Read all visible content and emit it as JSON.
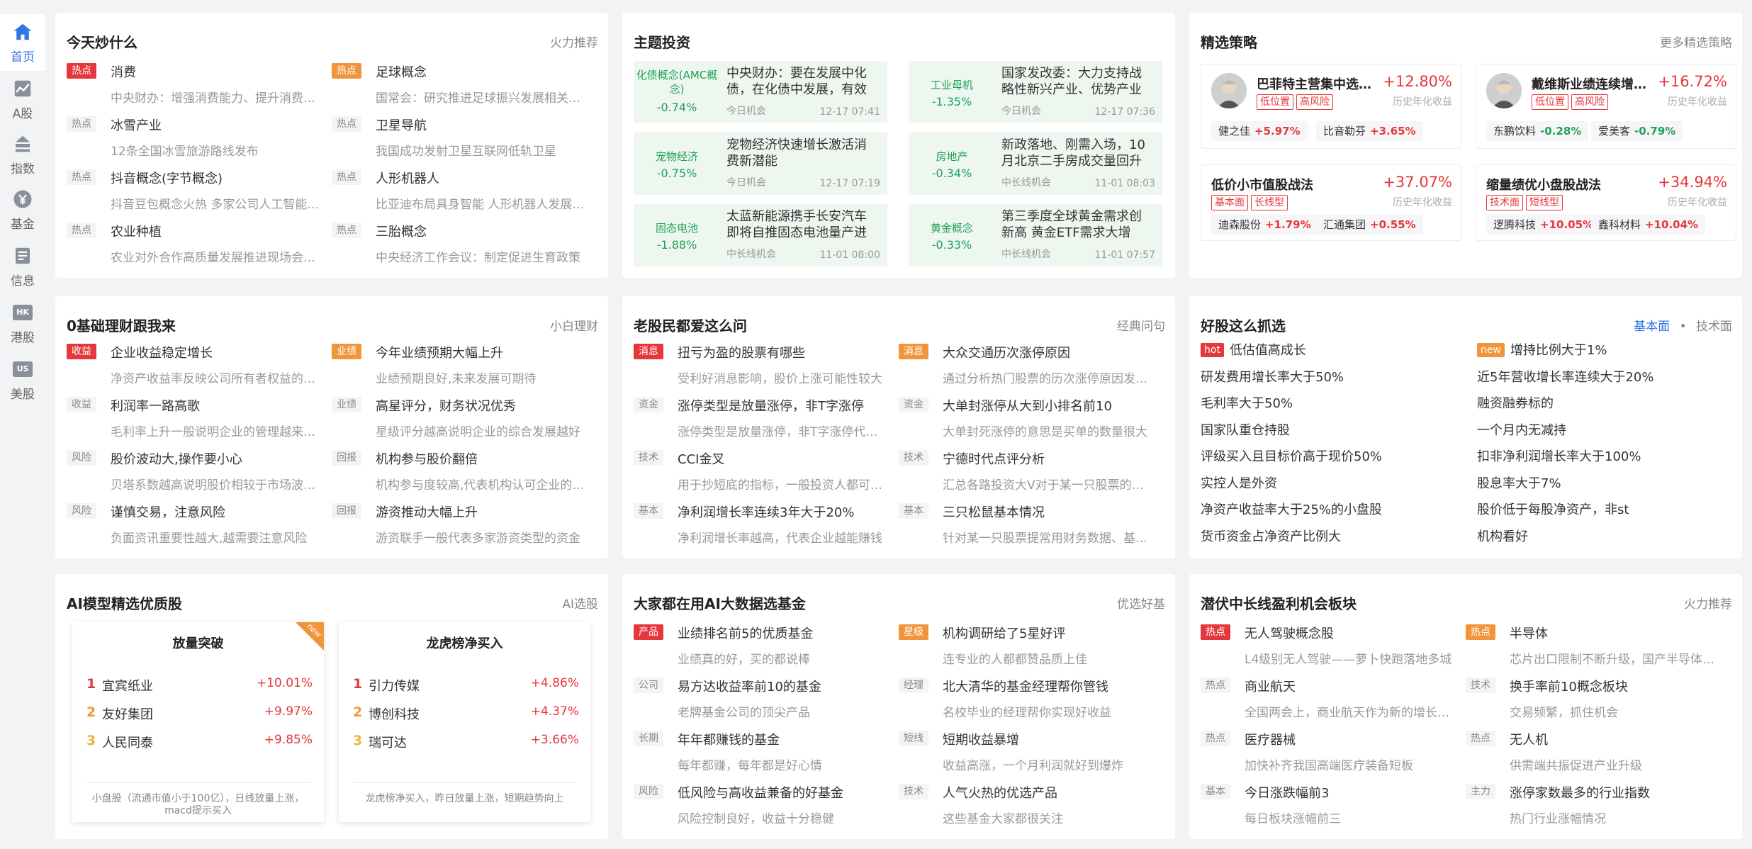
{
  "sidebar": [
    {
      "label": "首页",
      "icon": "home-icon",
      "active": true
    },
    {
      "label": "A股",
      "icon": "a-share-chart-icon"
    },
    {
      "label": "指数",
      "icon": "index-icon"
    },
    {
      "label": "基金",
      "icon": "fund-yen-icon"
    },
    {
      "label": "信息",
      "icon": "info-doc-icon"
    },
    {
      "label": "港股",
      "icon": "hk-icon",
      "badge": "HK"
    },
    {
      "label": "美股",
      "icon": "us-icon",
      "badge": "US"
    }
  ],
  "hot_topics": {
    "title": "今天炒什么",
    "more": "火力推荐",
    "items": [
      {
        "tag": "热点",
        "title": "消费",
        "sub": "中央财办：增强消费能力、提升消费意愿"
      },
      {
        "tag": "热点",
        "title": "足球概念",
        "sub": "国常会：研究推进足球振兴发展相关工作"
      },
      {
        "tag": "热点",
        "title": "冰雪产业",
        "sub": "12条全国冰雪旅游路线发布"
      },
      {
        "tag": "热点",
        "title": "卫星导航",
        "sub": "我国成功发射卫星互联网低轨卫星"
      },
      {
        "tag": "热点",
        "title": "抖音概念(字节概念)",
        "sub": "抖音豆包概念火热 多家公司人工智能合作"
      },
      {
        "tag": "热点",
        "title": "人形机器人",
        "sub": "比亚迪布局具身智能 人形机器人发展提速"
      },
      {
        "tag": "热点",
        "title": "农业种植",
        "sub": "农业对外合作高质量发展推进现场会召开"
      },
      {
        "tag": "热点",
        "title": "三胎概念",
        "sub": "中央经济工作会议：制定促进生育政策"
      }
    ]
  },
  "themes": {
    "title": "主题投资",
    "items": [
      {
        "name": "化债概念(AMC概念)",
        "pct": "-0.74%",
        "title": "中央财办：要在发展中化债，在化债中发展，有效防范风险",
        "source": "今日机会",
        "time": "12-17 07:41"
      },
      {
        "name": "工业母机",
        "pct": "-1.35%",
        "title": "国家发改委：大力支持战略性新兴产业、优势产业发展",
        "source": "今日机会",
        "time": "12-17 07:36"
      },
      {
        "name": "宠物经济",
        "pct": "-0.75%",
        "title": "宠物经济快速增长激活消费新潜能",
        "source": "今日机会",
        "time": "12-17 07:19"
      },
      {
        "name": "房地产",
        "pct": "-0.34%",
        "title": "新政落地、刚需入场，10月北京二手房成交量回升",
        "source": "中长线机会",
        "time": "11-01 08:03"
      },
      {
        "name": "固态电池",
        "pct": "-1.88%",
        "title": "太蓝新能源携手长安汽车 即将自推固态电池量产进程",
        "source": "中长线机会",
        "time": "11-01 08:00"
      },
      {
        "name": "黄金概念",
        "pct": "-0.33%",
        "title": "第三季度全球黄金需求创新高 黄金ETF需求大增",
        "source": "中长线机会",
        "time": "11-01 07:57"
      }
    ]
  },
  "strategies": {
    "title": "精选策略",
    "more": "更多精选策略",
    "items": [
      {
        "name": "巴菲特主营集中选股策略",
        "ret": "+12.80%",
        "label": "历史年化收益",
        "tags": [
          "低位置",
          "高风险"
        ],
        "stocks": [
          {
            "n": "健之佳",
            "v": "+5.97%"
          },
          {
            "n": "比音勒芬",
            "v": "+3.65%"
          }
        ],
        "avatar": true
      },
      {
        "name": "戴维斯业绩连续增长策略",
        "ret": "+16.72%",
        "label": "历史年化收益",
        "tags": [
          "低位置",
          "高风险"
        ],
        "stocks": [
          {
            "n": "东鹏饮料",
            "v": "-0.28%"
          },
          {
            "n": "爱美客",
            "v": "-0.79%"
          }
        ],
        "avatar": true
      },
      {
        "name": "低价小市值股战法",
        "ret": "+37.07%",
        "label": "历史年化收益",
        "tags": [
          "基本面",
          "长线型"
        ],
        "stocks": [
          {
            "n": "迪森股份",
            "v": "+1.79%"
          },
          {
            "n": "汇通集团",
            "v": "+0.55%"
          }
        ],
        "avatar": false
      },
      {
        "name": "缩量绩优小盘股战法",
        "ret": "+34.94%",
        "label": "历史年化收益",
        "tags": [
          "技术面",
          "短线型"
        ],
        "stocks": [
          {
            "n": "逻腾科技",
            "v": "+10.05%"
          },
          {
            "n": "鑫科材料",
            "v": "+10.04%"
          }
        ],
        "avatar": false
      }
    ]
  },
  "basics": {
    "title": "0基础理财跟我来",
    "more": "小白理财",
    "items": [
      {
        "tag": "收益",
        "hl": true,
        "title": "企业收益稳定增长",
        "sub": "净资产收益率反映公司所有者权益的投资回报"
      },
      {
        "tag": "业绩",
        "hl": "orange",
        "title": "今年业绩预期大幅上升",
        "sub": "业绩预期良好,未来发展可期待"
      },
      {
        "tag": "收益",
        "title": "利润率一路高歌",
        "sub": "毛利率上升一般说明企业的管理越来越好"
      },
      {
        "tag": "业绩",
        "title": "高星评分，财务状况优秀",
        "sub": "星级评分越高说明企业的综合发展越好"
      },
      {
        "tag": "风险",
        "title": "股价波动大,操作要小心",
        "sub": "贝塔系数越高说明股价相较于市场波动越大"
      },
      {
        "tag": "回报",
        "title": "机构参与股价翻倍",
        "sub": "机构参与度较高,代表机构认可企业的价值"
      },
      {
        "tag": "风险",
        "title": "谨慎交易，注意风险",
        "sub": "负面资讯重要性越大,越需要注意风险"
      },
      {
        "tag": "回报",
        "title": "游资推动大幅上升",
        "sub": "游资联手一般代表多家游资类型的资金"
      }
    ]
  },
  "veterans": {
    "title": "老股民都爱这么问",
    "more": "经典问句",
    "items": [
      {
        "tag": "消息",
        "hl": true,
        "title": "扭亏为盈的股票有哪些",
        "sub": "受利好消息影响，股价上涨可能性较大"
      },
      {
        "tag": "消息",
        "hl": "orange",
        "title": "大众交通历次涨停原因",
        "sub": "通过分析热门股票的历次涨停原因发现规律"
      },
      {
        "tag": "资金",
        "title": "涨停类型是放量涨停，非T字涨停",
        "sub": "涨停类型是放量涨停，非T字涨停代表资金积极"
      },
      {
        "tag": "资金",
        "title": "大单封涨停从大到小排名前10",
        "sub": "大单封死涨停的意思是买单的数量很大"
      },
      {
        "tag": "技术",
        "title": "CCI金叉",
        "sub": "用于抄短底的指标，一般投资人都可以参考"
      },
      {
        "tag": "技术",
        "title": "宁德时代点评分析",
        "sub": "汇总各路投资大V对于某一只股票的点评"
      },
      {
        "tag": "基本",
        "title": "净利润增长率连续3年大于20%",
        "sub": "净利润增长率越高，代表企业越能赚钱"
      },
      {
        "tag": "基本",
        "title": "三只松鼠基本情况",
        "sub": "针对某一只股票提常用财务数据、基本面"
      }
    ]
  },
  "screeners": {
    "title": "好股这么抓选",
    "tab_active": "基本面",
    "dot": "•",
    "tab_other": "技术面",
    "left": [
      {
        "tag": "hot",
        "text": "低估值高成长"
      },
      {
        "text": "研发费用增长率大于50%"
      },
      {
        "text": "毛利率大于50%"
      },
      {
        "text": "国家队重仓持股"
      },
      {
        "text": "评级买入且目标价高于现价50%"
      },
      {
        "text": "实控人是外资"
      },
      {
        "text": "净资产收益率大于25%的小盘股"
      },
      {
        "text": "货币资金占净资产比例大"
      }
    ],
    "right": [
      {
        "tag": "new",
        "text": "增持比例大于1%"
      },
      {
        "text": "近5年营收增长率连续大于20%"
      },
      {
        "text": "融资融券标的"
      },
      {
        "text": "一个月内无减持"
      },
      {
        "text": "扣非净利润增长率大于100%"
      },
      {
        "text": "股息率大于7%"
      },
      {
        "text": "股价低于每股净资产，非st"
      },
      {
        "text": "机构看好"
      }
    ]
  },
  "ai_picks": {
    "title": "AI模型精选优质股",
    "more": "AI选股",
    "boards": [
      {
        "title": "放量突破",
        "ribbon": "new",
        "rows": [
          {
            "n": "宜宾纸业",
            "v": "+10.01%"
          },
          {
            "n": "友好集团",
            "v": "+9.97%"
          },
          {
            "n": "人民同泰",
            "v": "+9.85%"
          }
        ],
        "foot": "小盘股（流通市值小于100亿），日线放量上涨，macd提示买入"
      },
      {
        "title": "龙虎榜净买入",
        "rows": [
          {
            "n": "引力传媒",
            "v": "+4.86%"
          },
          {
            "n": "博创科技",
            "v": "+4.37%"
          },
          {
            "n": "瑞可达",
            "v": "+3.66%"
          }
        ],
        "foot": "龙虎榜净买入，昨日放量上涨，短期趋势向上"
      }
    ],
    "rank_colors": [
      "#e5373c",
      "#f0953b",
      "#f0b23b"
    ]
  },
  "ai_funds": {
    "title": "大家都在用AI大数据选基金",
    "more": "优选好基",
    "items": [
      {
        "tag": "产品",
        "hl": true,
        "title": "业绩排名前5的优质基金",
        "sub": "业绩真的好，买的都说棒"
      },
      {
        "tag": "星级",
        "hl": "orange",
        "title": "机构调研给了5星好评",
        "sub": "连专业的人都都赞品质上佳"
      },
      {
        "tag": "公司",
        "title": "易方达收益率前10的基金",
        "sub": "老牌基金公司的顶尖产品"
      },
      {
        "tag": "经理",
        "title": "北大清华的基金经理帮你管钱",
        "sub": "名校毕业的经理帮你实现好收益"
      },
      {
        "tag": "长期",
        "title": "年年都赚钱的基金",
        "sub": "每年都赚，每年都是好心情"
      },
      {
        "tag": "短线",
        "title": "短期收益暴增",
        "sub": "收益高涨，一个月利润就好到爆炸"
      },
      {
        "tag": "风险",
        "title": "低风险与高收益兼备的好基金",
        "sub": "风险控制良好，收益十分稳健"
      },
      {
        "tag": "技术",
        "title": "人气火热的优选产品",
        "sub": "这些基金大家都很关注"
      }
    ]
  },
  "sectors": {
    "title": "潜伏中长线盈利机会板块",
    "more": "火力推荐",
    "items": [
      {
        "tag": "热点",
        "hl": true,
        "title": "无人驾驶概念股",
        "sub": "L4级别无人驾驶——萝卜快跑落地多城"
      },
      {
        "tag": "热点",
        "hl": "orange",
        "title": "半导体",
        "sub": "芯片出口限制不断升级，国产半导体迎机遇"
      },
      {
        "tag": "热点",
        "title": "商业航天",
        "sub": "全国两会上，商业航天作为新的增长引擎"
      },
      {
        "tag": "技术",
        "title": "换手率前10概念板块",
        "sub": "交易频繁，抓住机会"
      },
      {
        "tag": "热点",
        "title": "医疗器械",
        "sub": "加快补齐我国高端医疗装备短板"
      },
      {
        "tag": "热点",
        "title": "无人机",
        "sub": "供需端共振促进产业升级"
      },
      {
        "tag": "基本",
        "title": "今日涨跌幅前3",
        "sub": "每日板块涨幅前三"
      },
      {
        "tag": "主力",
        "title": "涨停家数最多的行业指数",
        "sub": "热门行业涨幅情况"
      }
    ]
  }
}
